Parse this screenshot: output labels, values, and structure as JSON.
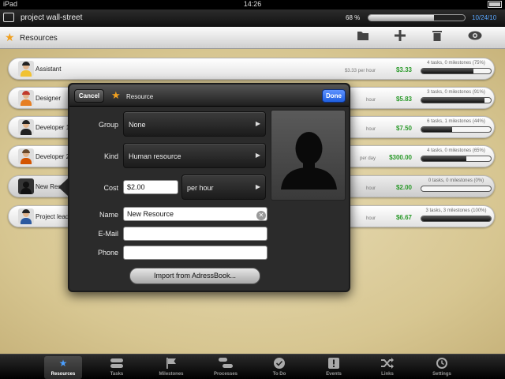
{
  "status_bar": {
    "device": "iPad",
    "time": "14:26"
  },
  "project_bar": {
    "name": "project wall-street",
    "percent": "68 %",
    "progress": 0.68,
    "date": "10/24/10"
  },
  "toolbar": {
    "title": "Resources"
  },
  "resources": [
    {
      "name": "Assistant",
      "rate": "$3.33 per hour",
      "amount": "$3.33",
      "tasks": "4 tasks, 0 milestones (75%)",
      "progress": 0.75
    },
    {
      "name": "Designer",
      "rate": "hour",
      "amount": "$5.83",
      "tasks": "3 tasks, 0 milestones (91%)",
      "progress": 0.91
    },
    {
      "name": "Developer 1",
      "rate": "hour",
      "amount": "$7.50",
      "tasks": "6 tasks, 1 milestones (44%)",
      "progress": 0.44
    },
    {
      "name": "Developer 2",
      "rate": "per day",
      "amount": "$300.00",
      "tasks": "4 tasks, 0 milestones (65%)",
      "progress": 0.65
    },
    {
      "name": "New Resource",
      "rate": "hour",
      "amount": "$2.00",
      "tasks": "0 tasks, 0 milestones (0%)",
      "progress": 0.0
    },
    {
      "name": "Project lead",
      "rate": "hour",
      "amount": "$6.67",
      "tasks": "3 tasks, 3 milestones (100%)",
      "progress": 1.0
    }
  ],
  "popover": {
    "cancel": "Cancel",
    "title": "Resource",
    "done": "Done",
    "group_label": "Group",
    "group_value": "None",
    "kind_label": "Kind",
    "kind_value": "Human resource",
    "cost_label": "Cost",
    "cost_value": "$2.00",
    "cost_unit": "per hour",
    "name_label": "Name",
    "name_value": "New Resource",
    "email_label": "E-Mail",
    "email_value": "",
    "phone_label": "Phone",
    "phone_value": "",
    "import": "Import from AdressBook..."
  },
  "tabs": [
    {
      "label": "Resources",
      "icon": "star-icon"
    },
    {
      "label": "Tasks",
      "icon": "tasks-icon"
    },
    {
      "label": "Milestones",
      "icon": "flag-icon"
    },
    {
      "label": "Processes",
      "icon": "processes-icon"
    },
    {
      "label": "To Do",
      "icon": "check-icon"
    },
    {
      "label": "Events",
      "icon": "exclamation-icon"
    },
    {
      "label": "Links",
      "icon": "shuffle-icon"
    },
    {
      "label": "Settings",
      "icon": "clock-icon"
    }
  ],
  "colors": {
    "accent": "#4b9fff",
    "amount": "#2a9a2a",
    "done_button": "#2f6fe8",
    "star": "#f0a020"
  }
}
